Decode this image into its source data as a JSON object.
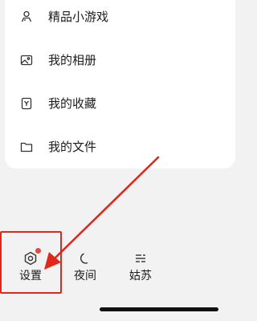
{
  "menu": {
    "items": [
      {
        "label": "精品小游戏",
        "icon": "mini-game-icon"
      },
      {
        "label": "我的相册",
        "icon": "album-icon"
      },
      {
        "label": "我的收藏",
        "icon": "favorites-icon"
      },
      {
        "label": "我的文件",
        "icon": "folder-icon"
      }
    ]
  },
  "bottom_bar": {
    "items": [
      {
        "label": "设置",
        "icon": "settings-icon",
        "has_badge": true
      },
      {
        "label": "夜间",
        "icon": "moon-icon",
        "has_badge": false
      },
      {
        "label": "姑苏",
        "icon": "weather-icon",
        "has_badge": false
      }
    ]
  },
  "annotation": {
    "color": "#e0271c",
    "badge_color": "#e8483f"
  }
}
